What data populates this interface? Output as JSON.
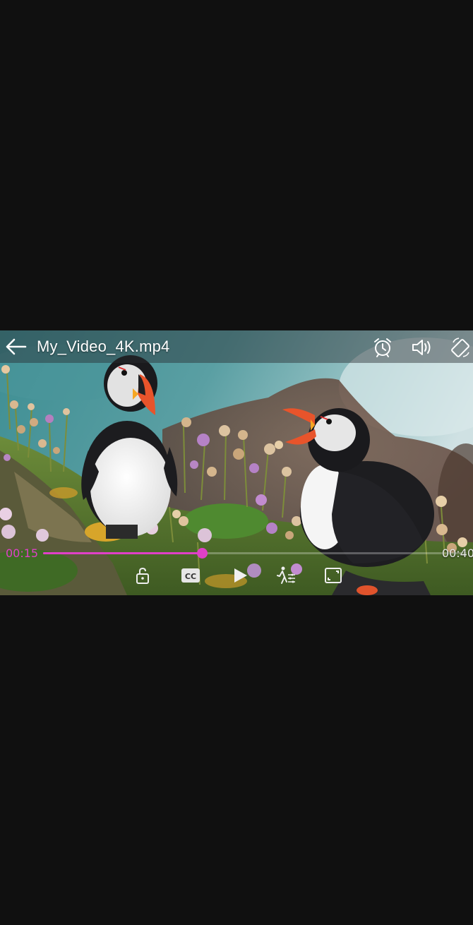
{
  "header": {
    "title": "My_Video_4K.mp4"
  },
  "playback": {
    "current_time": "00:15",
    "total_time": "00:40",
    "progress": 0.375
  },
  "colors": {
    "accent": "#e040c8",
    "background": "#101010"
  },
  "icons": {
    "back": "arrow-left",
    "timer": "alarm-clock",
    "volume": "speaker",
    "rotate": "screen-rotation",
    "lock": "padlock",
    "subtitles": "closed-captions",
    "play": "play-triangle",
    "equalizer": "figure-with-sliders",
    "aspect": "resize-frame"
  }
}
